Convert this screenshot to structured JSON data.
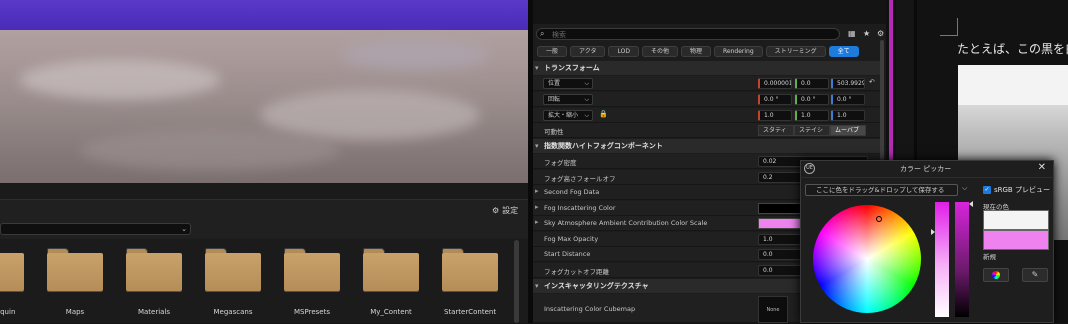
{
  "details": {
    "search_placeholder": "検索",
    "tabs": [
      "一般",
      "アクタ",
      "LOD",
      "その他",
      "物理",
      "Rendering",
      "ストリーミング",
      "全て"
    ],
    "transform": {
      "title": "トランスフォーム",
      "location_label": "位置",
      "location": [
        "0.000001",
        "0.0",
        "503.9929"
      ],
      "rotation_label": "回転",
      "rotation": [
        "0.0 °",
        "0.0 °",
        "0.0 °"
      ],
      "scale_label": "拡大・縮小",
      "scale": [
        "1.0",
        "1.0",
        "1.0"
      ],
      "mobility_label": "可動性",
      "mobility_options": [
        "スタティ",
        "ステイシ",
        "ムーバブ"
      ]
    },
    "fog": {
      "title": "指数関数ハイトフォグコンポーネント",
      "rows": [
        {
          "label": "フォグ密度",
          "value": "0.02"
        },
        {
          "label": "フォグ高さフォールオフ",
          "value": "0.2"
        },
        {
          "label": "Second Fog Data",
          "value": ""
        },
        {
          "label": "Fog Inscattering Color",
          "value": ""
        },
        {
          "label": "Sky Atmosphere Ambient Contribution Color Scale",
          "value": ""
        },
        {
          "label": "Fog Max Opacity",
          "value": "1.0"
        },
        {
          "label": "Start Distance",
          "value": "0.0"
        },
        {
          "label": "フォグカットオフ距離",
          "value": "0.0"
        }
      ]
    },
    "inscatter": {
      "title": "インスキャッタリングテクスチャ",
      "cubemap_label": "Inscattering Color Cubemap",
      "thumb_text": "None"
    }
  },
  "browser": {
    "settings_label": "設定",
    "folders": [
      "Mannequin",
      "Maps",
      "Materials",
      "Megascans",
      "MSPresets",
      "My_Content",
      "StarterContent"
    ]
  },
  "picker": {
    "title": "カラー ピッカー",
    "logo": "UE",
    "drop_hint": "ここに色をドラッグ&ドロップして保存する",
    "srgb_label": "sRGB プレビュー",
    "current_label": "現在の色",
    "new_label": "新規",
    "colors": {
      "current": "#f4f4f4",
      "new": "#ee82ee",
      "fog_inscatter": "#000000",
      "sky_scale": "#ee82ee"
    }
  },
  "doc": {
    "text": "たとえば、この黒を白"
  },
  "colors": {
    "accent": "#1e7bdb",
    "viewport_sky": "#5a38c8",
    "folder": "#c9a16a"
  }
}
